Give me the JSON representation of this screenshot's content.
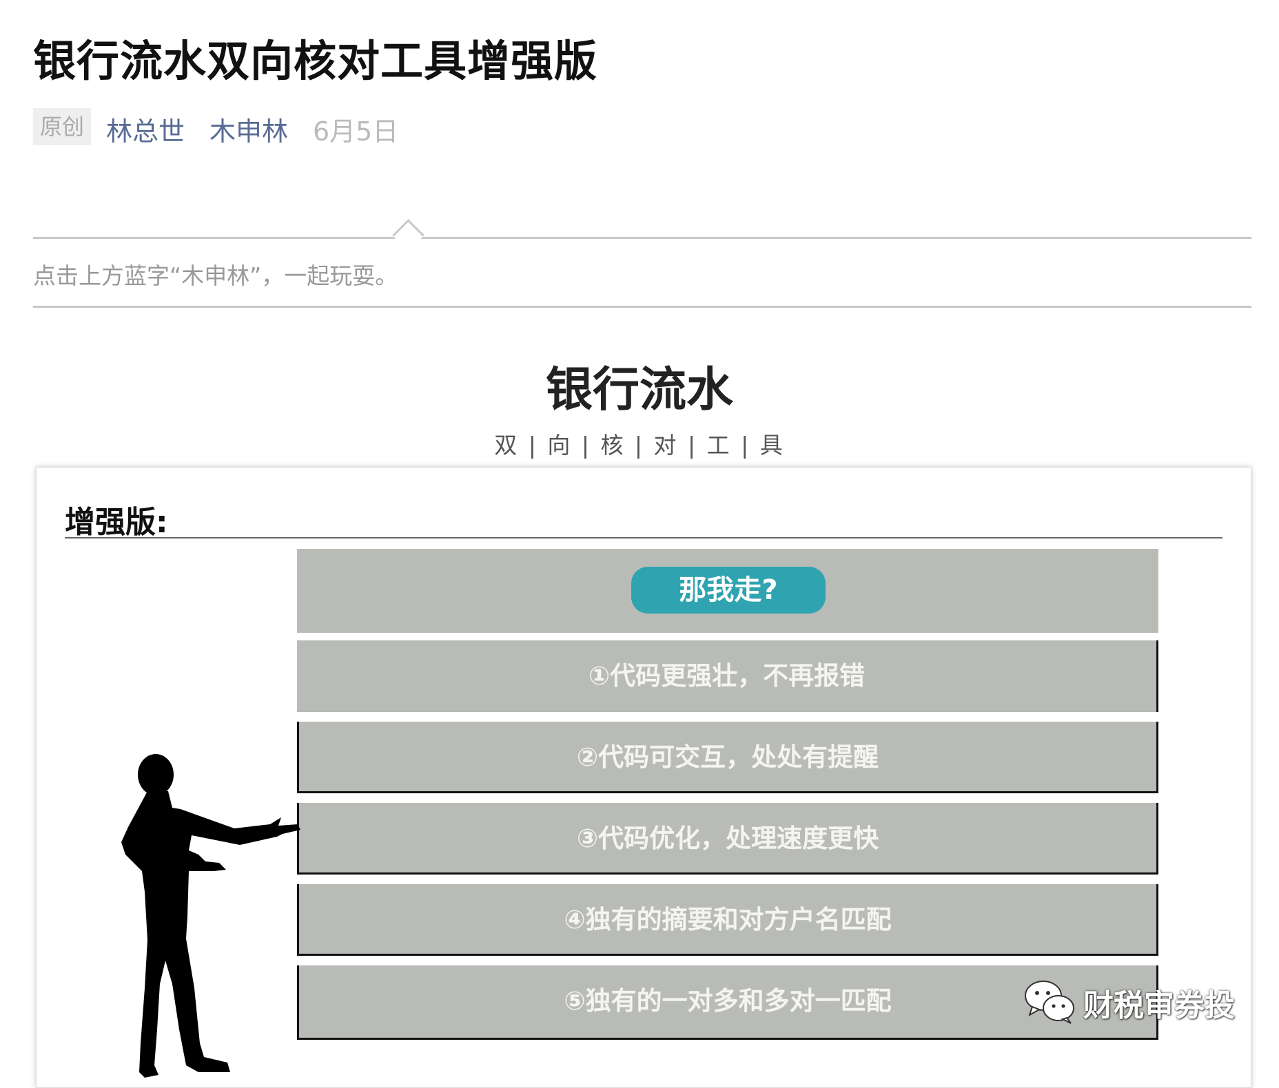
{
  "article": {
    "title": "银行流水双向核对工具增强版",
    "badge": "原创",
    "author": "林总世",
    "account": "木申林",
    "date": "6月5日"
  },
  "quote": {
    "text": "点击上方蓝字“木申林”，一起玩耍。"
  },
  "section": {
    "title": "银行流水",
    "subtitle": "双 | 向 | 核 | 对 | 工 | 具"
  },
  "card": {
    "title": "增强版:",
    "cta": "那我走?",
    "features": [
      "①代码更强壮，不再报错",
      "②代码可交互，处处有提醒",
      "③代码优化，处理速度更快",
      "④独有的摘要和对方户名匹配",
      "⑤独有的一对多和多对一匹配"
    ]
  },
  "watermark": {
    "text": "财税审券投",
    "icon": "wechat-icon"
  },
  "colors": {
    "link": "#576b95",
    "cta": "#2fa3b0",
    "bar": "#b9bcb6"
  }
}
